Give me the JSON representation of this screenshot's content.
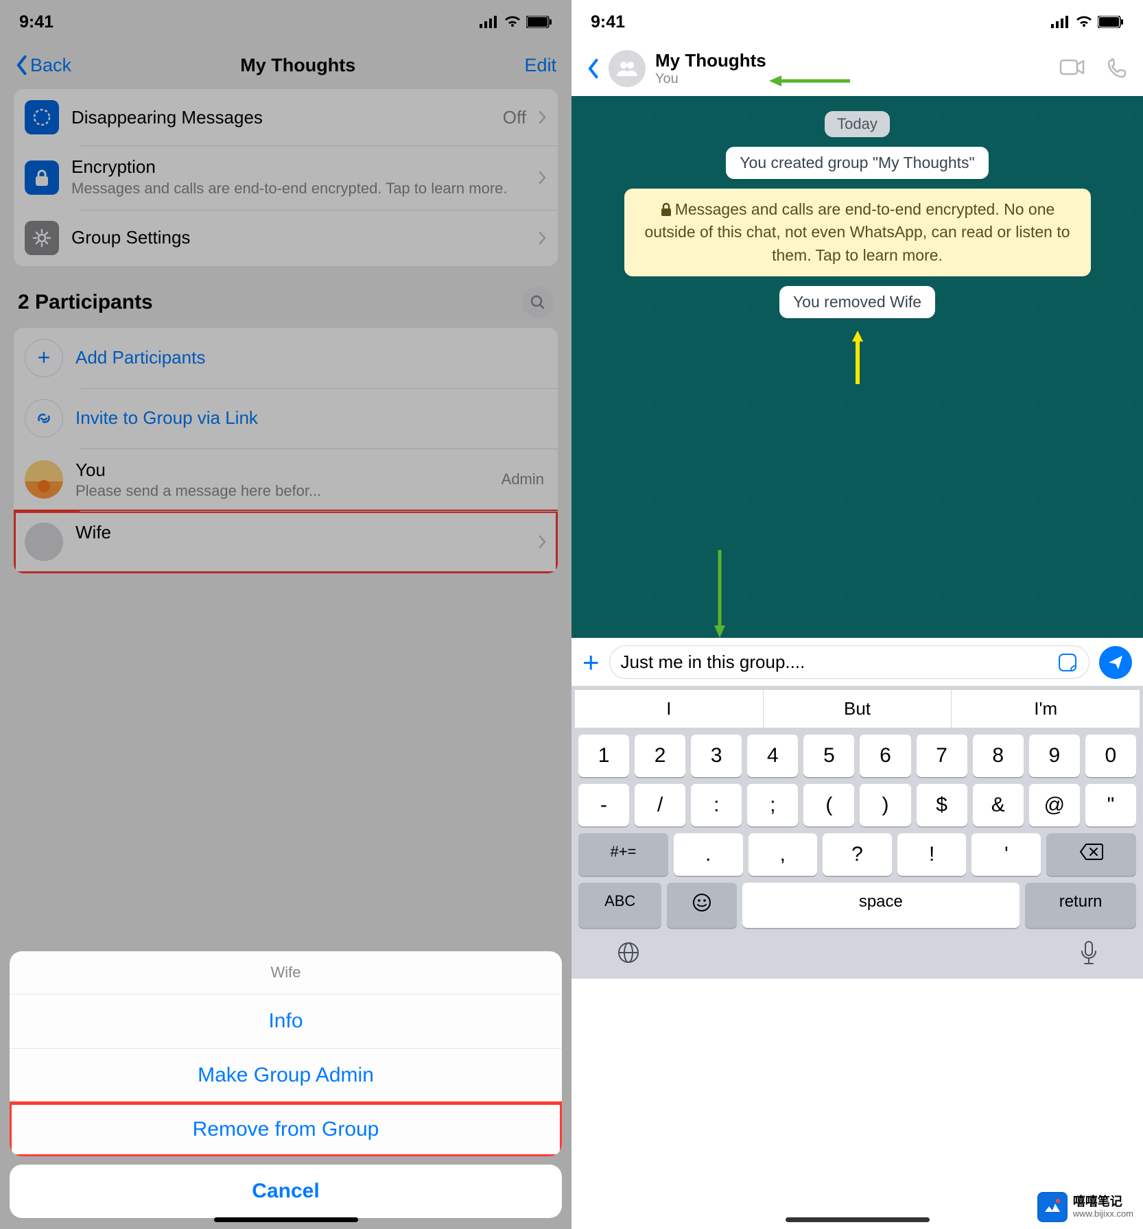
{
  "status": {
    "time": "9:41"
  },
  "left": {
    "nav": {
      "back": "Back",
      "title": "My Thoughts",
      "edit": "Edit"
    },
    "settings": {
      "disappearing": {
        "label": "Disappearing Messages",
        "value": "Off"
      },
      "encryption": {
        "label": "Encryption",
        "sub": "Messages and calls are end-to-end encrypted. Tap to learn more."
      },
      "group_settings": "Group Settings"
    },
    "participants": {
      "title": "2 Participants",
      "add": "Add Participants",
      "invite": "Invite to Group via Link",
      "you": {
        "name": "You",
        "sub": "Please send a message here befor...",
        "role": "Admin"
      },
      "wife": {
        "name": "Wife"
      }
    },
    "sheet": {
      "title": "Wife",
      "info": "Info",
      "make_admin": "Make Group Admin",
      "remove": "Remove from Group",
      "cancel": "Cancel"
    }
  },
  "right": {
    "header": {
      "title": "My Thoughts",
      "sub": "You"
    },
    "chat": {
      "date": "Today",
      "created": "You created group \"My Thoughts\"",
      "encryption": "Messages and calls are end-to-end encrypted. No one outside of this chat, not even WhatsApp, can read or listen to them. Tap to learn more.",
      "removed": "You removed Wife"
    },
    "input": {
      "text": "Just me in this group...."
    },
    "suggestions": [
      "I",
      "But",
      "I'm"
    ],
    "kb_row1": [
      "1",
      "2",
      "3",
      "4",
      "5",
      "6",
      "7",
      "8",
      "9",
      "0"
    ],
    "kb_row2": [
      "-",
      "/",
      ":",
      ";",
      "(",
      ")",
      "$",
      "&",
      "@",
      "\""
    ],
    "kb_row3_label": "#+=",
    "kb_row3": [
      ".",
      ",",
      "?",
      "!",
      "'"
    ],
    "kb_abc": "ABC",
    "kb_space": "space",
    "kb_return": "return"
  },
  "watermark": {
    "cn": "嘻嘻笔记",
    "url": "www.bijixx.com"
  }
}
